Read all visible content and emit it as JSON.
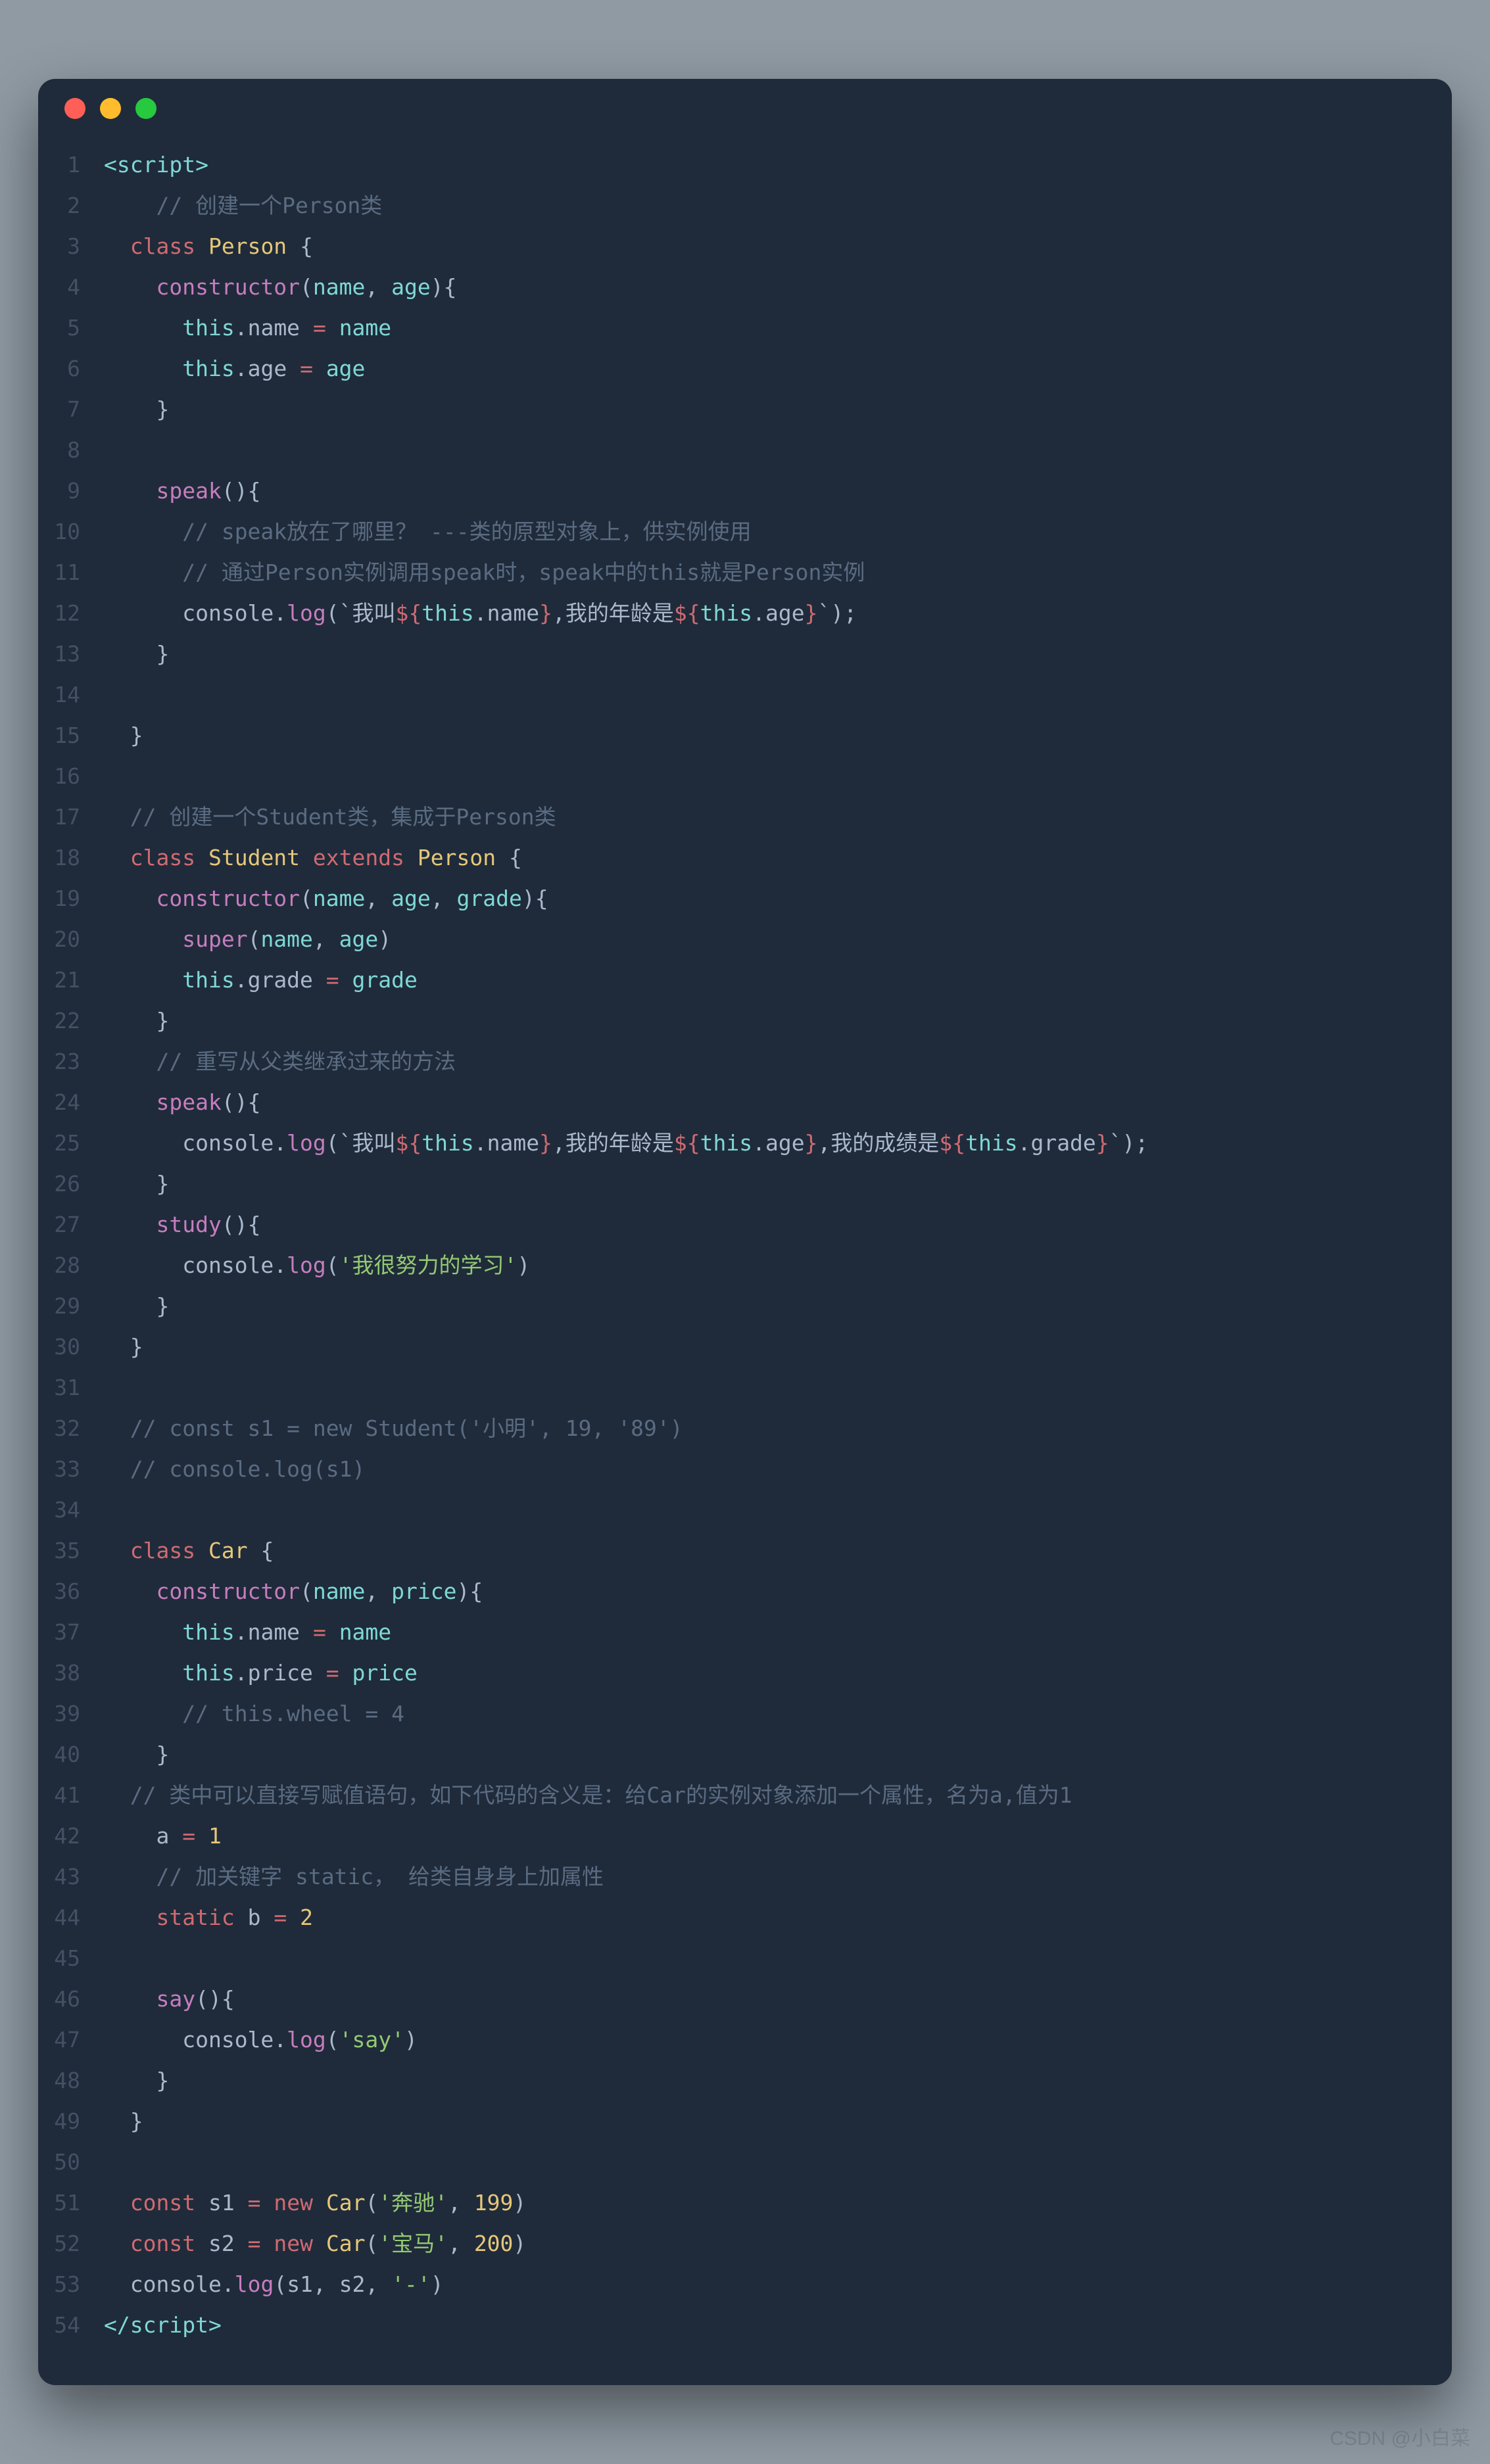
{
  "window": {
    "traffic_lights": [
      "close",
      "minimize",
      "zoom"
    ]
  },
  "watermark": "CSDN @小白菜",
  "code": {
    "language": "javascript-in-html",
    "lines": [
      [
        [
          "angle",
          "<"
        ],
        [
          "tag",
          "script"
        ],
        [
          "angle",
          ">"
        ]
      ],
      [
        [
          "default",
          "    "
        ],
        [
          "comment",
          "// 创建一个Person类"
        ]
      ],
      [
        [
          "default",
          "  "
        ],
        [
          "kw",
          "class"
        ],
        [
          "default",
          " "
        ],
        [
          "class",
          "Person"
        ],
        [
          "default",
          " "
        ],
        [
          "punc",
          "{"
        ]
      ],
      [
        [
          "default",
          "    "
        ],
        [
          "fn",
          "constructor"
        ],
        [
          "punc",
          "("
        ],
        [
          "param",
          "name"
        ],
        [
          "punc",
          ", "
        ],
        [
          "param",
          "age"
        ],
        [
          "punc",
          "){"
        ]
      ],
      [
        [
          "default",
          "      "
        ],
        [
          "this",
          "this"
        ],
        [
          "punc",
          "."
        ],
        [
          "prop",
          "name"
        ],
        [
          "default",
          " "
        ],
        [
          "op",
          "="
        ],
        [
          "default",
          " "
        ],
        [
          "param",
          "name"
        ]
      ],
      [
        [
          "default",
          "      "
        ],
        [
          "this",
          "this"
        ],
        [
          "punc",
          "."
        ],
        [
          "prop",
          "age"
        ],
        [
          "default",
          " "
        ],
        [
          "op",
          "="
        ],
        [
          "default",
          " "
        ],
        [
          "param",
          "age"
        ]
      ],
      [
        [
          "default",
          "    "
        ],
        [
          "punc",
          "}"
        ]
      ],
      [],
      [
        [
          "default",
          "    "
        ],
        [
          "fn",
          "speak"
        ],
        [
          "punc",
          "(){"
        ]
      ],
      [
        [
          "default",
          "      "
        ],
        [
          "comment",
          "// speak放在了哪里？ ---类的原型对象上，供实例使用"
        ]
      ],
      [
        [
          "default",
          "      "
        ],
        [
          "comment",
          "// 通过Person实例调用speak时，speak中的this就是Person实例"
        ]
      ],
      [
        [
          "default",
          "      "
        ],
        [
          "prop",
          "console"
        ],
        [
          "punc",
          "."
        ],
        [
          "fn",
          "log"
        ],
        [
          "punc",
          "("
        ],
        [
          "str",
          "`我叫"
        ],
        [
          "interp",
          "${"
        ],
        [
          "this",
          "this"
        ],
        [
          "punc",
          "."
        ],
        [
          "prop",
          "name"
        ],
        [
          "interp",
          "}"
        ],
        [
          "str",
          ",我的年龄是"
        ],
        [
          "interp",
          "${"
        ],
        [
          "this",
          "this"
        ],
        [
          "punc",
          "."
        ],
        [
          "prop",
          "age"
        ],
        [
          "interp",
          "}"
        ],
        [
          "str",
          "`"
        ],
        [
          "punc",
          ");"
        ]
      ],
      [
        [
          "default",
          "    "
        ],
        [
          "punc",
          "}"
        ]
      ],
      [],
      [
        [
          "default",
          "  "
        ],
        [
          "punc",
          "}"
        ]
      ],
      [],
      [
        [
          "default",
          "  "
        ],
        [
          "comment",
          "// 创建一个Student类，集成于Person类"
        ]
      ],
      [
        [
          "default",
          "  "
        ],
        [
          "kw",
          "class"
        ],
        [
          "default",
          " "
        ],
        [
          "class",
          "Student"
        ],
        [
          "default",
          " "
        ],
        [
          "kw",
          "extends"
        ],
        [
          "default",
          " "
        ],
        [
          "class",
          "Person"
        ],
        [
          "default",
          " "
        ],
        [
          "punc",
          "{"
        ]
      ],
      [
        [
          "default",
          "    "
        ],
        [
          "fn",
          "constructor"
        ],
        [
          "punc",
          "("
        ],
        [
          "param",
          "name"
        ],
        [
          "punc",
          ", "
        ],
        [
          "param",
          "age"
        ],
        [
          "punc",
          ", "
        ],
        [
          "param",
          "grade"
        ],
        [
          "punc",
          "){"
        ]
      ],
      [
        [
          "default",
          "      "
        ],
        [
          "super",
          "super"
        ],
        [
          "punc",
          "("
        ],
        [
          "param",
          "name"
        ],
        [
          "punc",
          ", "
        ],
        [
          "param",
          "age"
        ],
        [
          "punc",
          ")"
        ]
      ],
      [
        [
          "default",
          "      "
        ],
        [
          "this",
          "this"
        ],
        [
          "punc",
          "."
        ],
        [
          "prop",
          "grade"
        ],
        [
          "default",
          " "
        ],
        [
          "op",
          "="
        ],
        [
          "default",
          " "
        ],
        [
          "param",
          "grade"
        ]
      ],
      [
        [
          "default",
          "    "
        ],
        [
          "punc",
          "}"
        ]
      ],
      [
        [
          "default",
          "    "
        ],
        [
          "comment",
          "// 重写从父类继承过来的方法"
        ]
      ],
      [
        [
          "default",
          "    "
        ],
        [
          "fn",
          "speak"
        ],
        [
          "punc",
          "(){"
        ]
      ],
      [
        [
          "default",
          "      "
        ],
        [
          "prop",
          "console"
        ],
        [
          "punc",
          "."
        ],
        [
          "fn",
          "log"
        ],
        [
          "punc",
          "("
        ],
        [
          "str",
          "`我叫"
        ],
        [
          "interp",
          "${"
        ],
        [
          "this",
          "this"
        ],
        [
          "punc",
          "."
        ],
        [
          "prop",
          "name"
        ],
        [
          "interp",
          "}"
        ],
        [
          "str",
          ",我的年龄是"
        ],
        [
          "interp",
          "${"
        ],
        [
          "this",
          "this"
        ],
        [
          "punc",
          "."
        ],
        [
          "prop",
          "age"
        ],
        [
          "interp",
          "}"
        ],
        [
          "str",
          ",我的成绩是"
        ],
        [
          "interp",
          "${"
        ],
        [
          "this",
          "this"
        ],
        [
          "punc",
          "."
        ],
        [
          "prop",
          "grade"
        ],
        [
          "interp",
          "}"
        ],
        [
          "str",
          "`"
        ],
        [
          "punc",
          ");"
        ]
      ],
      [
        [
          "default",
          "    "
        ],
        [
          "punc",
          "}"
        ]
      ],
      [
        [
          "default",
          "    "
        ],
        [
          "fn",
          "study"
        ],
        [
          "punc",
          "(){"
        ]
      ],
      [
        [
          "default",
          "      "
        ],
        [
          "prop",
          "console"
        ],
        [
          "punc",
          "."
        ],
        [
          "fn",
          "log"
        ],
        [
          "punc",
          "("
        ],
        [
          "str2",
          "'我很努力的学习'"
        ],
        [
          "punc",
          ")"
        ]
      ],
      [
        [
          "default",
          "    "
        ],
        [
          "punc",
          "}"
        ]
      ],
      [
        [
          "default",
          "  "
        ],
        [
          "punc",
          "}"
        ]
      ],
      [],
      [
        [
          "default",
          "  "
        ],
        [
          "comment",
          "// const s1 = new Student('小明', 19, '89')"
        ]
      ],
      [
        [
          "default",
          "  "
        ],
        [
          "comment",
          "// console.log(s1)"
        ]
      ],
      [],
      [
        [
          "default",
          "  "
        ],
        [
          "kw",
          "class"
        ],
        [
          "default",
          " "
        ],
        [
          "class",
          "Car"
        ],
        [
          "default",
          " "
        ],
        [
          "punc",
          "{"
        ]
      ],
      [
        [
          "default",
          "    "
        ],
        [
          "fn",
          "constructor"
        ],
        [
          "punc",
          "("
        ],
        [
          "param",
          "name"
        ],
        [
          "punc",
          ", "
        ],
        [
          "param",
          "price"
        ],
        [
          "punc",
          "){"
        ]
      ],
      [
        [
          "default",
          "      "
        ],
        [
          "this",
          "this"
        ],
        [
          "punc",
          "."
        ],
        [
          "prop",
          "name"
        ],
        [
          "default",
          " "
        ],
        [
          "op",
          "="
        ],
        [
          "default",
          " "
        ],
        [
          "param",
          "name"
        ]
      ],
      [
        [
          "default",
          "      "
        ],
        [
          "this",
          "this"
        ],
        [
          "punc",
          "."
        ],
        [
          "prop",
          "price"
        ],
        [
          "default",
          " "
        ],
        [
          "op",
          "="
        ],
        [
          "default",
          " "
        ],
        [
          "param",
          "price"
        ]
      ],
      [
        [
          "default",
          "      "
        ],
        [
          "comment",
          "// this.wheel = 4"
        ]
      ],
      [
        [
          "default",
          "    "
        ],
        [
          "punc",
          "}"
        ]
      ],
      [
        [
          "default",
          "  "
        ],
        [
          "comment",
          "// 类中可以直接写赋值语句，如下代码的含义是：给Car的实例对象添加一个属性，名为a,值为1"
        ]
      ],
      [
        [
          "default",
          "    "
        ],
        [
          "prop",
          "a"
        ],
        [
          "default",
          " "
        ],
        [
          "op",
          "="
        ],
        [
          "default",
          " "
        ],
        [
          "num",
          "1"
        ]
      ],
      [
        [
          "default",
          "    "
        ],
        [
          "comment",
          "// 加关键字 static， 给类自身身上加属性"
        ]
      ],
      [
        [
          "default",
          "    "
        ],
        [
          "kw",
          "static"
        ],
        [
          "default",
          " "
        ],
        [
          "prop",
          "b"
        ],
        [
          "default",
          " "
        ],
        [
          "op",
          "="
        ],
        [
          "default",
          " "
        ],
        [
          "num",
          "2"
        ]
      ],
      [],
      [
        [
          "default",
          "    "
        ],
        [
          "fn",
          "say"
        ],
        [
          "punc",
          "(){"
        ]
      ],
      [
        [
          "default",
          "      "
        ],
        [
          "prop",
          "console"
        ],
        [
          "punc",
          "."
        ],
        [
          "fn",
          "log"
        ],
        [
          "punc",
          "("
        ],
        [
          "str2",
          "'say'"
        ],
        [
          "punc",
          ")"
        ]
      ],
      [
        [
          "default",
          "    "
        ],
        [
          "punc",
          "}"
        ]
      ],
      [
        [
          "default",
          "  "
        ],
        [
          "punc",
          "}"
        ]
      ],
      [],
      [
        [
          "default",
          "  "
        ],
        [
          "kw",
          "const"
        ],
        [
          "default",
          " "
        ],
        [
          "prop",
          "s1"
        ],
        [
          "default",
          " "
        ],
        [
          "op",
          "="
        ],
        [
          "default",
          " "
        ],
        [
          "kw",
          "new"
        ],
        [
          "default",
          " "
        ],
        [
          "class",
          "Car"
        ],
        [
          "punc",
          "("
        ],
        [
          "str2",
          "'奔驰'"
        ],
        [
          "punc",
          ", "
        ],
        [
          "num",
          "199"
        ],
        [
          "punc",
          ")"
        ]
      ],
      [
        [
          "default",
          "  "
        ],
        [
          "kw",
          "const"
        ],
        [
          "default",
          " "
        ],
        [
          "prop",
          "s2"
        ],
        [
          "default",
          " "
        ],
        [
          "op",
          "="
        ],
        [
          "default",
          " "
        ],
        [
          "kw",
          "new"
        ],
        [
          "default",
          " "
        ],
        [
          "class",
          "Car"
        ],
        [
          "punc",
          "("
        ],
        [
          "str2",
          "'宝马'"
        ],
        [
          "punc",
          ", "
        ],
        [
          "num",
          "200"
        ],
        [
          "punc",
          ")"
        ]
      ],
      [
        [
          "default",
          "  "
        ],
        [
          "prop",
          "console"
        ],
        [
          "punc",
          "."
        ],
        [
          "fn",
          "log"
        ],
        [
          "punc",
          "("
        ],
        [
          "prop",
          "s1"
        ],
        [
          "punc",
          ", "
        ],
        [
          "prop",
          "s2"
        ],
        [
          "punc",
          ", "
        ],
        [
          "str2",
          "'-'"
        ],
        [
          "punc",
          ")"
        ]
      ],
      [
        [
          "angle",
          "</"
        ],
        [
          "tag",
          "script"
        ],
        [
          "angle",
          ">"
        ]
      ]
    ]
  }
}
